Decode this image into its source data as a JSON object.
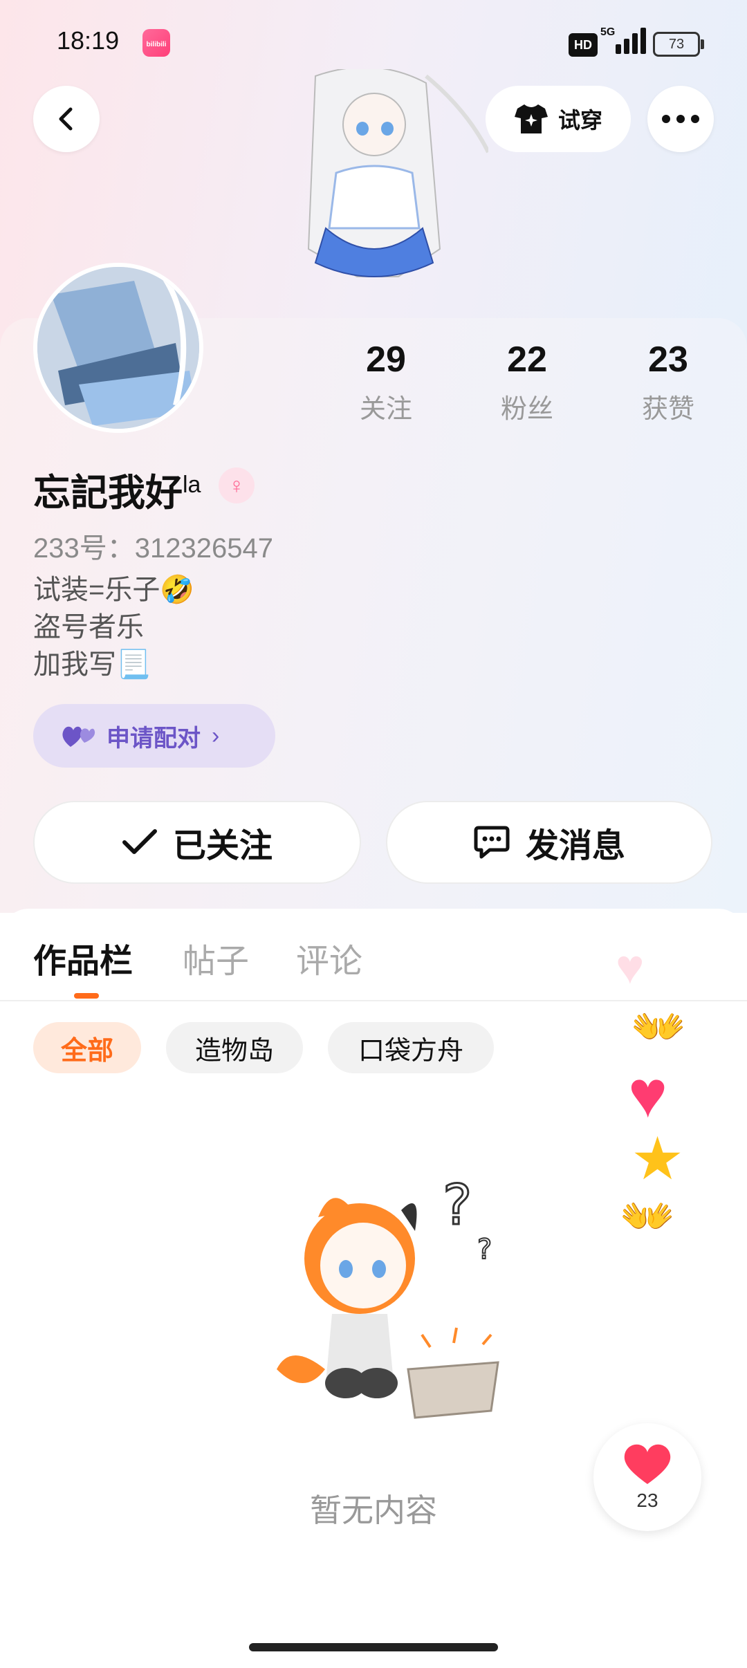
{
  "status_bar": {
    "time": "18:19",
    "app_badge": "bilibili",
    "network": "5G",
    "battery": "73",
    "hd_label": "HD"
  },
  "header": {
    "try_on_label": "试穿"
  },
  "profile": {
    "stats": [
      {
        "value": "29",
        "label": "关注"
      },
      {
        "value": "22",
        "label": "粉丝"
      },
      {
        "value": "23",
        "label": "获赞"
      }
    ],
    "name": "忘記我好",
    "name_suffix": "la",
    "uid": "233号：312326547",
    "bio_lines": [
      "试装=乐子🤣",
      "盗号者乐",
      "加我写📃"
    ],
    "pair_button": "申请配对",
    "follow_button": "已关注",
    "message_button": "发消息"
  },
  "tabs": [
    "作品栏",
    "帖子",
    "评论"
  ],
  "filters": [
    "全部",
    "造物岛",
    "口袋方舟"
  ],
  "empty_text": "暂无内容",
  "like_count": "23",
  "colors": {
    "accent": "#ff6b1a",
    "pair": "#6c55c7",
    "heart": "#ff4d6d"
  }
}
